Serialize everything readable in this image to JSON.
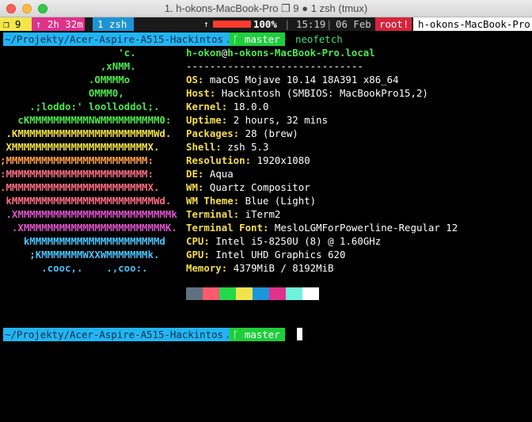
{
  "window": {
    "title": "1. h-okons-MacBook-Pro ❐ 9 ● 1 zsh (tmux)"
  },
  "status_bar": {
    "session": "❐ 9",
    "uptime": "↑ 2h 32m",
    "window": "1 zsh",
    "battery_icon": "↑",
    "battery_level": 1.0,
    "battery_percent": "100%",
    "time": "15:19",
    "date": "06 Feb",
    "separator": "|",
    "root_label": "root!",
    "hostname": "h-okons-MacBook-Pro",
    "colors": {
      "session": "#f3e64a",
      "uptime": "#e0318b",
      "window": "#1e94d6",
      "root": "#d7243a",
      "battery": "#ff3b30"
    }
  },
  "prompt1": {
    "path": "~/Projekty/Acer-Aspire-A515-Hackintosh",
    "branch_icon": "ᚴ",
    "branch": "master",
    "command": "neofetch"
  },
  "prompt2": {
    "path": "~/Projekty/Acer-Aspire-A515-Hackintosh",
    "branch_icon": "ᚴ",
    "branch": "master"
  },
  "logo": [
    {
      "text": "                    'c.",
      "color": "green"
    },
    {
      "text": "                 ,xNMM.",
      "color": "green"
    },
    {
      "text": "               .OMMMMo",
      "color": "green"
    },
    {
      "text": "               OMMM0,",
      "color": "green"
    },
    {
      "text": "     .;loddo:' loolloddol;.",
      "color": "green"
    },
    {
      "text": "   cKMMMMMMMMMMNWMMMMMMMMMM0:",
      "color": "green"
    },
    {
      "text": " .KMMMMMMMMMMMMMMMMMMMMMMMWd.",
      "color": "yellow"
    },
    {
      "text": " XMMMMMMMMMMMMMMMMMMMMMMMX.",
      "color": "yellow"
    },
    {
      "text": ";MMMMMMMMMMMMMMMMMMMMMMMM:",
      "color": "orange"
    },
    {
      "text": ":MMMMMMMMMMMMMMMMMMMMMMMM:",
      "color": "red"
    },
    {
      "text": ".MMMMMMMMMMMMMMMMMMMMMMMMX.",
      "color": "red"
    },
    {
      "text": " kMMMMMMMMMMMMMMMMMMMMMMMMWd.",
      "color": "red"
    },
    {
      "text": " .XMMMMMMMMMMMMMMMMMMMMMMMMMMk",
      "color": "pink"
    },
    {
      "text": "  .XMMMMMMMMMMMMMMMMMMMMMMMMK.",
      "color": "pink"
    },
    {
      "text": "    kMMMMMMMMMMMMMMMMMMMMMMd",
      "color": "blue"
    },
    {
      "text": "     ;KMMMMMMMWXXWMMMMMMMk.",
      "color": "blue"
    },
    {
      "text": "       .cooc,.    .,coo:.",
      "color": "blue"
    }
  ],
  "info": {
    "user": "h-okon",
    "at": "@",
    "host": "h-okons-MacBook-Pro.local",
    "separator_line": "------------------------------",
    "lines": [
      {
        "key": "OS",
        "value": "macOS Mojave 10.14 18A391 x86_64"
      },
      {
        "key": "Host",
        "value": "Hackintosh (SMBIOS: MacBookPro15,2)"
      },
      {
        "key": "Kernel",
        "value": "18.0.0"
      },
      {
        "key": "Uptime",
        "value": "2 hours, 32 mins"
      },
      {
        "key": "Packages",
        "value": "28 (brew)"
      },
      {
        "key": "Shell",
        "value": "zsh 5.3"
      },
      {
        "key": "Resolution",
        "value": "1920x1080"
      },
      {
        "key": "DE",
        "value": "Aqua"
      },
      {
        "key": "WM",
        "value": "Quartz Compositor"
      },
      {
        "key": "WM Theme",
        "value": "Blue (Light)"
      },
      {
        "key": "Terminal",
        "value": "iTerm2"
      },
      {
        "key": "Terminal Font",
        "value": "MesloLGMForPowerline-Regular 12"
      },
      {
        "key": "CPU",
        "value": "Intel i5-8250U (8) @ 1.60GHz"
      },
      {
        "key": "GPU",
        "value": "Intel UHD Graphics 620"
      },
      {
        "key": "Memory",
        "value": "4379MiB / 8192MiB"
      }
    ],
    "key_suffix": ":"
  },
  "swatches": [
    "#607180",
    "#ff5a6e",
    "#23d84a",
    "#f3e34a",
    "#1d95da",
    "#e0318b",
    "#6ef2dc",
    "#ffffff"
  ]
}
